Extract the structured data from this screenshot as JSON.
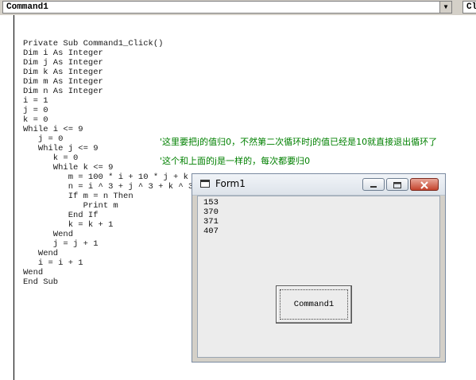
{
  "toolbar": {
    "object_combo_value": "Command1",
    "procedure_combo_value": "Cl"
  },
  "code_lines": [
    "Private Sub Command1_Click()",
    "Dim i As Integer",
    "Dim j As Integer",
    "Dim k As Integer",
    "Dim m As Integer",
    "Dim n As Integer",
    "i = 1",
    "j = 0",
    "k = 0",
    "While i <= 9",
    "   j = 0",
    "   While j <= 9",
    "      k = 0",
    "      While k <= 9",
    "         m = 100 * i + 10 * j + k",
    "         n = i ^ 3 + j ^ 3 + k ^ 3",
    "         If m = n Then",
    "            Print m",
    "         End If",
    "         k = k + 1",
    "      Wend",
    "      j = j + 1",
    "   Wend",
    "   i = i + 1",
    "Wend",
    "End Sub"
  ],
  "comments": {
    "line_j": "'这里要把j的值归0，不然第二次循环时j的值已经是10就直接退出循环了",
    "line_k": "'这个和上面的j是一样的，每次都要归0"
  },
  "colors": {
    "comment": "#008000",
    "code": "#1a1a1a"
  },
  "form_window": {
    "title": "Form1",
    "icon": "form-icon",
    "output_lines": [
      "153",
      "370",
      "371",
      "407"
    ],
    "button_label": "Command1"
  }
}
